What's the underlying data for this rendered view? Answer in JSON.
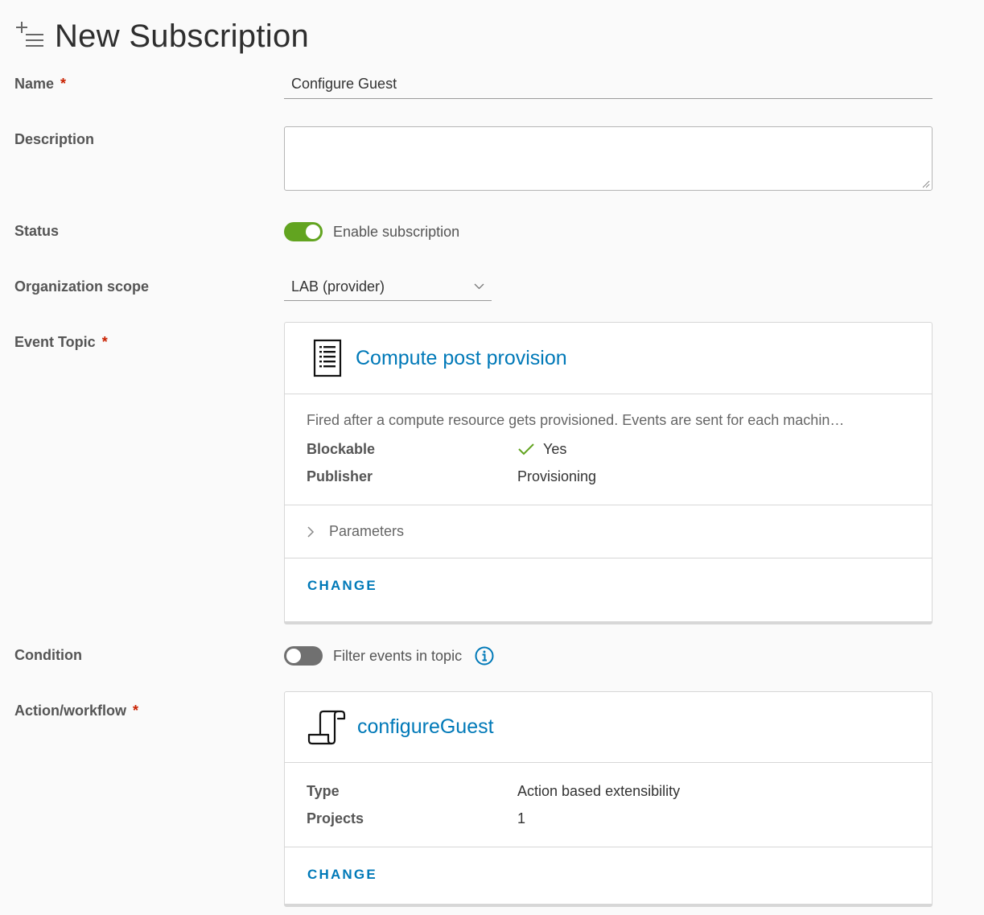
{
  "header": {
    "title": "New Subscription",
    "icon": "add-list-icon"
  },
  "form": {
    "name": {
      "label": "Name",
      "required_mark": "*",
      "value": "Configure Guest"
    },
    "description": {
      "label": "Description",
      "value": ""
    },
    "status": {
      "label": "Status",
      "toggle_text": "Enable subscription",
      "enabled": true
    },
    "org_scope": {
      "label": "Organization scope",
      "selected": "LAB (provider)"
    },
    "event_topic": {
      "label": "Event Topic",
      "required_mark": "*",
      "card": {
        "icon": "document-list-icon",
        "title": "Compute post provision",
        "description": "Fired after a compute resource gets provisioned. Events are sent for each machin…",
        "rows": [
          {
            "key": "Blockable",
            "value": "Yes",
            "icon": "check-icon"
          },
          {
            "key": "Publisher",
            "value": "Provisioning"
          }
        ],
        "parameters_label": "Parameters",
        "change_label": "CHANGE"
      }
    },
    "condition": {
      "label": "Condition",
      "toggle_text": "Filter events in topic",
      "enabled": false,
      "info_icon": "info-icon"
    },
    "action": {
      "label": "Action/workflow",
      "required_mark": "*",
      "card": {
        "icon": "scroll-icon",
        "title": "configureGuest",
        "rows": [
          {
            "key": "Type",
            "value": "Action based extensibility"
          },
          {
            "key": "Projects",
            "value": "1"
          }
        ],
        "change_label": "CHANGE"
      }
    }
  },
  "colors": {
    "accent": "#0079b8",
    "toggle_on": "#62a420",
    "toggle_off": "#707070",
    "required": "#c92100"
  }
}
